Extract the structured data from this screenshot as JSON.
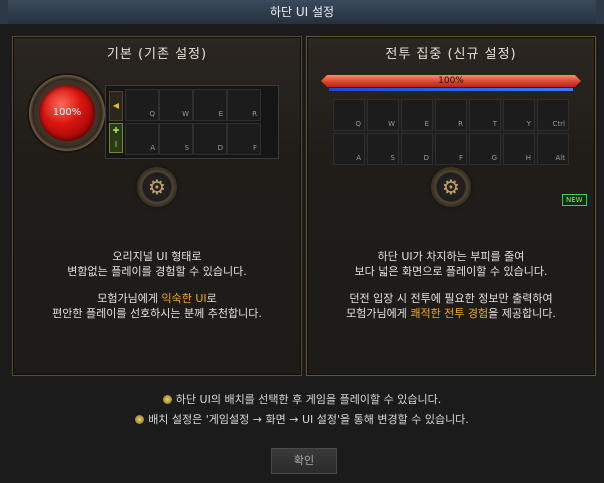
{
  "window": {
    "title": "하단 UI 설정"
  },
  "panels": {
    "basic": {
      "title": "기본 (기존 설정)",
      "orb_percent": "100%",
      "keys_top": [
        "Q",
        "W",
        "E",
        "R"
      ],
      "keys_bottom": [
        "A",
        "S",
        "D",
        "F"
      ],
      "desc1_line1": "오리지널 UI 형태로",
      "desc1_line2": "변함없는 플레이를 경험할 수 있습니다.",
      "desc2_line1_a": "모험가님에게 ",
      "desc2_line1_hl": "익숙한 UI",
      "desc2_line1_b": "로",
      "desc2_line2": "편안한 플레이를 선호하시는 분께 추천합니다."
    },
    "combat": {
      "title": "전투 집중 (신규 설정)",
      "hp_percent": "100%",
      "keys_top": [
        "Q",
        "W",
        "E",
        "R",
        "T",
        "Y",
        "Ctrl"
      ],
      "keys_bottom": [
        "A",
        "S",
        "D",
        "F",
        "G",
        "H",
        "Alt"
      ],
      "badge": "NEW",
      "desc1_line1": "하단 UI가 차지하는 부피를 줄여",
      "desc1_line2": "보다 넓은 화면으로 플레이할 수 있습니다.",
      "desc2_line1": "던전 입장 시 전투에 필요한 정보만 출력하여",
      "desc2_line2_a": "모험가님에게 ",
      "desc2_line2_hl": "쾌적한 전투 경험",
      "desc2_line2_b": "을 제공합니다."
    }
  },
  "notes": [
    "하단 UI의 배치를 선택한 후 게임을 플레이할 수 있습니다.",
    "배치 설정은 '게임설정 → 화면 → UI 설정'을 통해 변경할 수 있습니다."
  ],
  "confirm_label": "확인",
  "colors": {
    "highlight": "#f0a820",
    "panel_border": "#5a4a2e",
    "new_badge": "#3ad04a"
  },
  "icons": {
    "settings": "gear-icon",
    "arrow_left": "triangle-left-icon",
    "bullet": "gold-coin-bullet-icon"
  }
}
